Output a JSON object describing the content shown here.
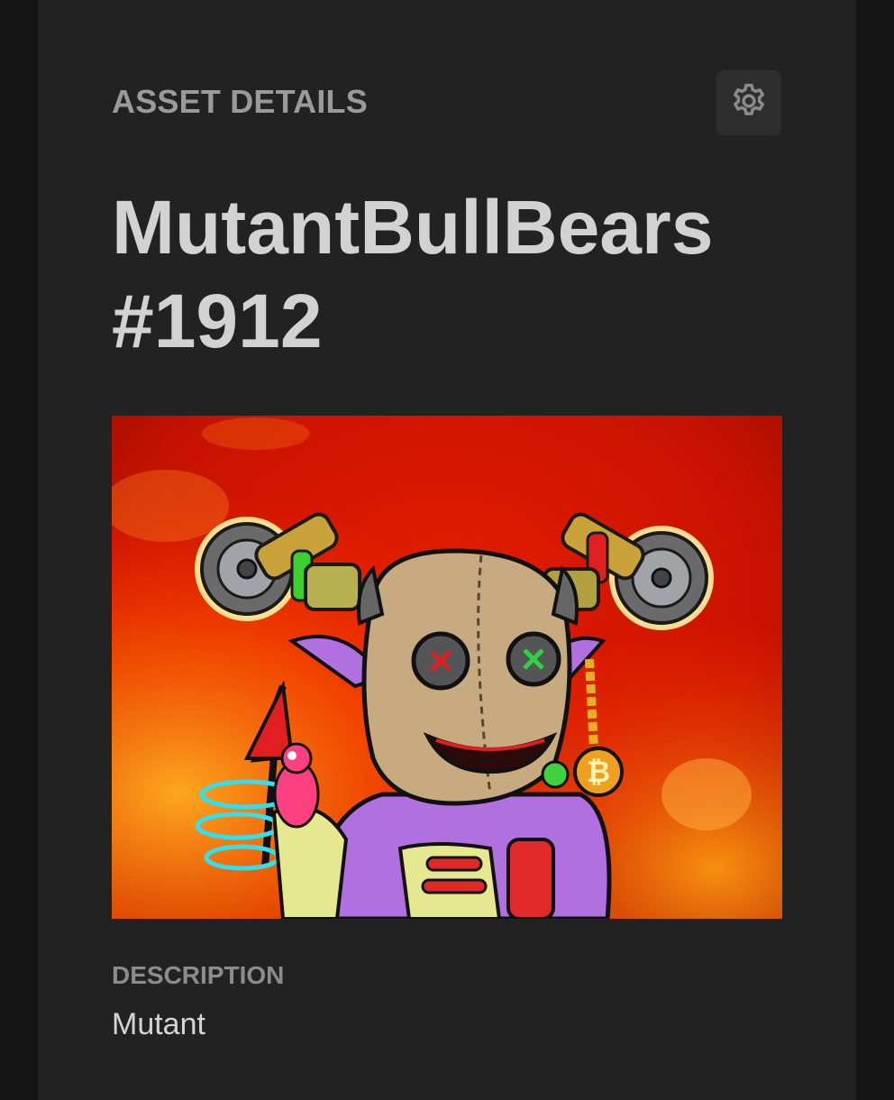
{
  "header": {
    "section_label": "ASSET DETAILS",
    "settings_icon": "gear-icon"
  },
  "asset": {
    "title_line1": "MutantBullBears",
    "title_line2": "#1912",
    "image_subject": "mutant-bullbear-nft-artwork"
  },
  "description": {
    "label": "DESCRIPTION",
    "value": "Mutant"
  },
  "colors": {
    "background": "#141414",
    "card": "#222222",
    "label": "#9a9a9a",
    "title": "#d2d2d2"
  }
}
